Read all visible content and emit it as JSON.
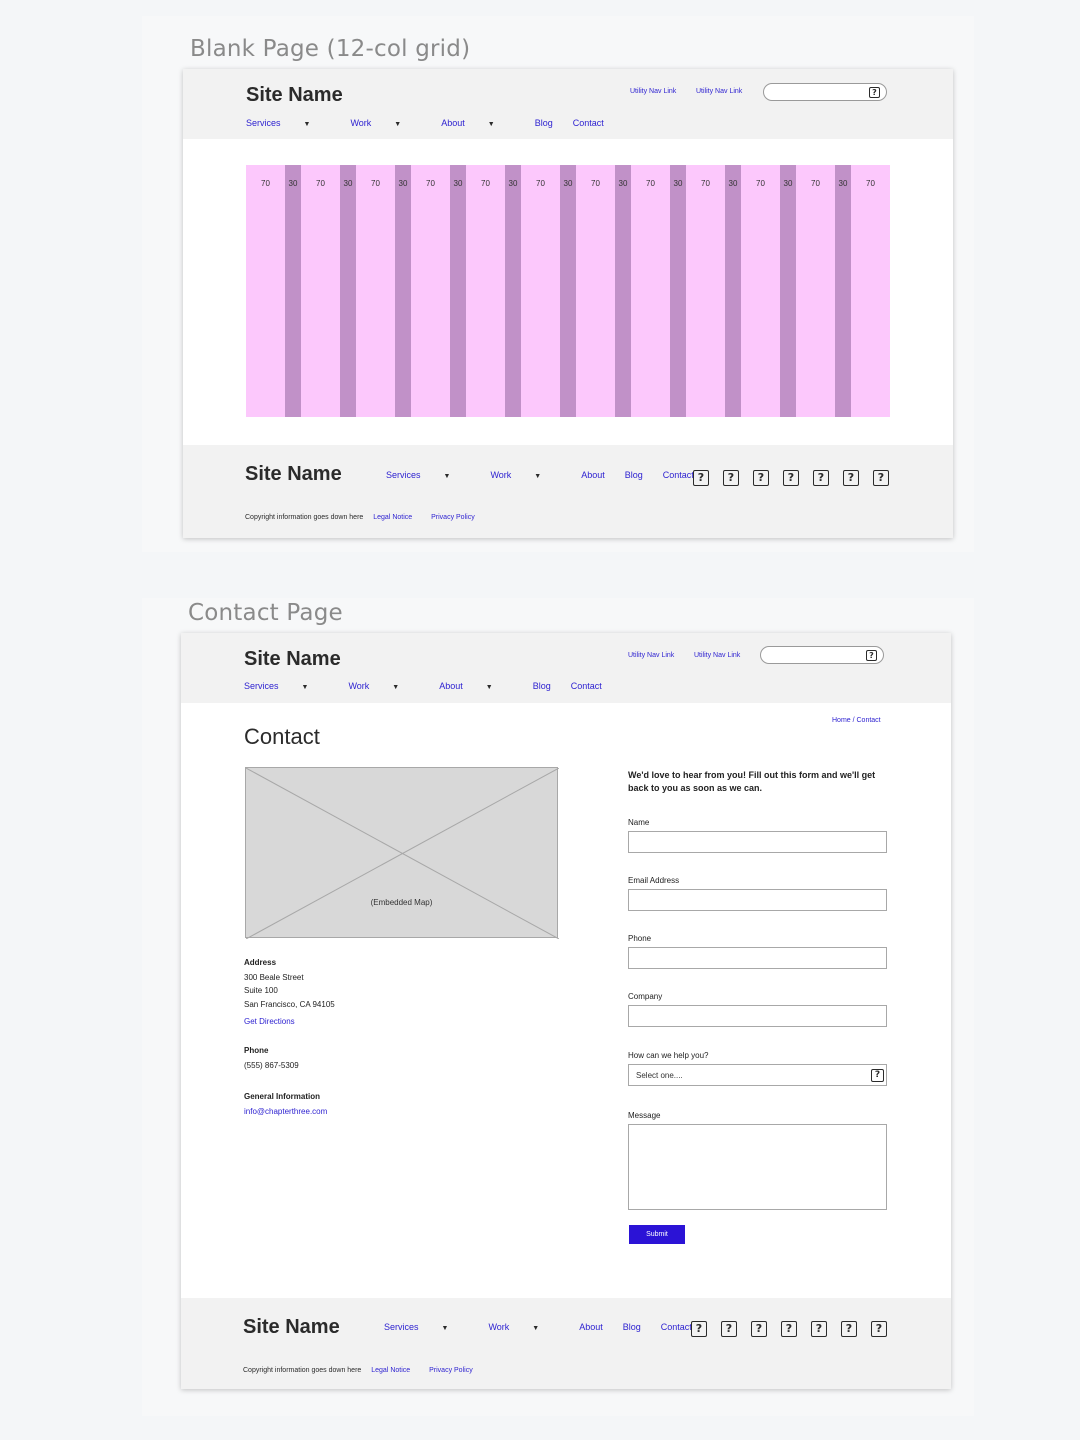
{
  "blank_page": {
    "artboard_title": "Blank Page (12-col grid)",
    "header": {
      "site_name": "Site Name",
      "utility_links": [
        "Utility Nav Link",
        "Utility Nav Link"
      ],
      "nav": {
        "services": "Services",
        "work": "Work",
        "about": "About",
        "blog": "Blog",
        "contact": "Contact"
      }
    },
    "grid": {
      "columns": [
        "70",
        "30",
        "70",
        "30",
        "70",
        "30",
        "70",
        "30",
        "70",
        "30",
        "70",
        "30",
        "70",
        "30",
        "70",
        "30",
        "70",
        "30",
        "70",
        "30",
        "70",
        "30",
        "70"
      ],
      "column_color": "#fcc8fc",
      "gutter_color": "#c191c8"
    },
    "footer": {
      "site_name": "Site Name",
      "nav": {
        "services": "Services",
        "work": "Work",
        "about": "About",
        "blog": "Blog",
        "contact": "Contact"
      },
      "social_icons": [
        "?",
        "?",
        "?",
        "?",
        "?",
        "?",
        "?"
      ],
      "copyright": "Copyright information goes down here",
      "legal_notice": "Legal Notice",
      "privacy_policy": "Privacy Policy"
    }
  },
  "contact_page": {
    "artboard_title": "Contact Page",
    "header": {
      "site_name": "Site Name",
      "utility_links": [
        "Utility Nav Link",
        "Utility Nav Link"
      ],
      "nav": {
        "services": "Services",
        "work": "Work",
        "about": "About",
        "blog": "Blog",
        "contact": "Contact"
      }
    },
    "breadcrumb": "Home / Contact",
    "title": "Contact",
    "map_label": "(Embedded Map)",
    "address": {
      "heading": "Address",
      "line1": "300 Beale Street",
      "line2": "Suite 100",
      "line3": "San Francisco, CA 94105",
      "directions": "Get Directions"
    },
    "phone": {
      "heading": "Phone",
      "value": "(555) 867-5309"
    },
    "general": {
      "heading": "General Information",
      "email": "info@chapterthree.com"
    },
    "form": {
      "intro": "We'd love to hear from you! Fill out this form and we'll get back to you as soon as we can.",
      "name_label": "Name",
      "email_label": "Email Address",
      "phone_label": "Phone",
      "company_label": "Company",
      "help_label": "How can we help you?",
      "help_value": "Select one....",
      "message_label": "Message",
      "submit": "Submit"
    },
    "footer": {
      "site_name": "Site Name",
      "nav": {
        "services": "Services",
        "work": "Work",
        "about": "About",
        "blog": "Blog",
        "contact": "Contact"
      },
      "social_icons": [
        "?",
        "?",
        "?",
        "?",
        "?",
        "?",
        "?"
      ],
      "copyright": "Copyright information goes down here",
      "legal_notice": "Legal Notice",
      "privacy_policy": "Privacy Policy"
    }
  },
  "colors": {
    "link": "#2b1fd0",
    "submit": "#2b13d6",
    "header_bg": "#f2f2f2"
  }
}
